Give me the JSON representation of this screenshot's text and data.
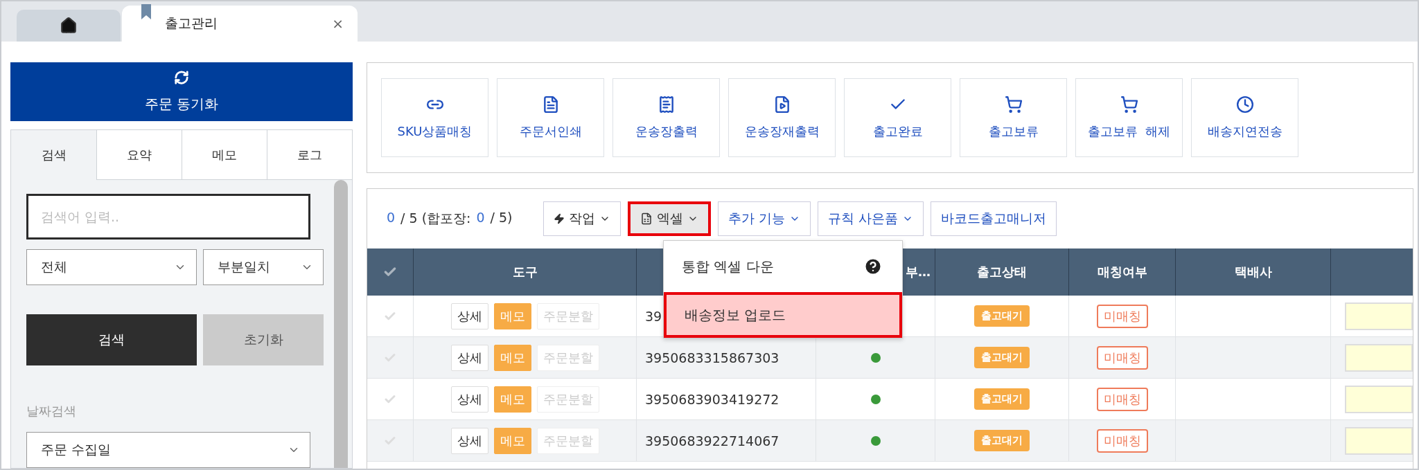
{
  "tab_bar": {
    "home_selected": false,
    "tabs": [
      {
        "label": "출고관리",
        "selected": true,
        "close": "×"
      }
    ]
  },
  "sidebar": {
    "sync_button": "주문 동기화",
    "tabs": [
      {
        "label": "검색",
        "selected": true
      },
      {
        "label": "요약",
        "selected": false
      },
      {
        "label": "메모",
        "selected": false
      },
      {
        "label": "로그",
        "selected": false
      }
    ],
    "search": {
      "placeholder": "검색어 입력.."
    },
    "selects": [
      {
        "value": "전체"
      },
      {
        "value": "부분일치"
      }
    ],
    "search_button": "검색",
    "reset_button": "초기화",
    "date_label": "날짜검색",
    "date_select": {
      "value": "주문 수집일"
    }
  },
  "actions": [
    {
      "label": "SKU상품매칭"
    },
    {
      "label": "주문서인쇄"
    },
    {
      "label": "운송장출력"
    },
    {
      "label": "운송장재출력"
    },
    {
      "label": "출고완료"
    },
    {
      "label": "출고보류"
    },
    {
      "label": "출고보류  해제"
    },
    {
      "label": "배송지연전송"
    }
  ],
  "summary": [
    {
      "text": "0",
      "kind": "count"
    },
    {
      "text": "/ 5 (합포장:",
      "kind": "plain"
    },
    {
      "text": "0",
      "kind": "count"
    },
    {
      "text": "/ 5)",
      "kind": "plain"
    }
  ],
  "grid_buttons": [
    {
      "label": "작업",
      "kind": "work",
      "dropdown": true,
      "highlighted": false
    },
    {
      "label": "엑셀",
      "kind": "excel",
      "dropdown": true,
      "highlighted": true
    },
    {
      "label": "추가 기능",
      "kind": "link",
      "dropdown": true,
      "highlighted": false
    },
    {
      "label": "규칙 사은품",
      "kind": "link",
      "dropdown": true,
      "highlighted": false
    },
    {
      "label": "바코드출고매니저",
      "kind": "link",
      "dropdown": false,
      "highlighted": false
    }
  ],
  "excel_menu": [
    {
      "label": "통합 엑셀 다운",
      "help": true,
      "highlighted": false
    },
    {
      "label": "배송정보 업로드",
      "help": false,
      "highlighted": true
    }
  ],
  "table": {
    "columns": [
      "도구",
      "부…",
      "출고상태",
      "매칭여부",
      "택배사"
    ],
    "rows": [
      {
        "tools": [
          {
            "label": "상세",
            "kind": "detail",
            "disabled": false
          },
          {
            "label": "메모",
            "kind": "memo",
            "disabled": false
          },
          {
            "label": "주문분할",
            "kind": "split",
            "disabled": true
          }
        ],
        "order_no": "39",
        "status": "출고대기",
        "matching": "미매칭"
      },
      {
        "tools": [
          {
            "label": "상세",
            "kind": "detail",
            "disabled": false
          },
          {
            "label": "메모",
            "kind": "memo",
            "disabled": false
          },
          {
            "label": "주문분할",
            "kind": "split",
            "disabled": true
          }
        ],
        "order_no": "3950683315867303",
        "dot": true,
        "status": "출고대기",
        "matching": "미매칭"
      },
      {
        "tools": [
          {
            "label": "상세",
            "kind": "detail",
            "disabled": false
          },
          {
            "label": "메모",
            "kind": "memo",
            "disabled": false
          },
          {
            "label": "주문분할",
            "kind": "split",
            "disabled": true
          }
        ],
        "order_no": "3950683903419272",
        "dot": true,
        "status": "출고대기",
        "matching": "미매칭"
      },
      {
        "tools": [
          {
            "label": "상세",
            "kind": "detail",
            "disabled": false
          },
          {
            "label": "메모",
            "kind": "memo",
            "disabled": false
          },
          {
            "label": "주문분할",
            "kind": "split",
            "disabled": true
          }
        ],
        "order_no": "3950683922714067",
        "dot": true,
        "status": "출고대기",
        "matching": "미매칭"
      }
    ]
  }
}
